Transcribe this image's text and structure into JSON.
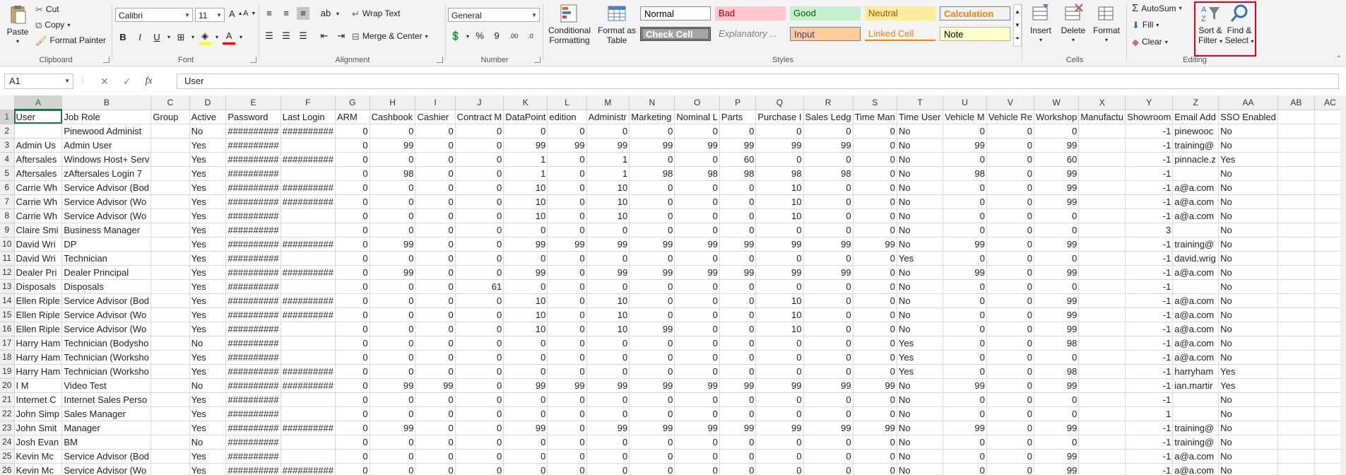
{
  "ribbon": {
    "clipboard": {
      "paste": "Paste",
      "cut": "Cut",
      "copy": "Copy",
      "format_painter": "Format Painter",
      "group": "Clipboard"
    },
    "font": {
      "name": "Calibri",
      "size": "11",
      "bold": "B",
      "italic": "I",
      "underline": "U",
      "group": "Font"
    },
    "alignment": {
      "wrap_text": "Wrap Text",
      "merge_center": "Merge & Center",
      "group": "Alignment"
    },
    "number": {
      "format": "General",
      "percent": "%",
      "comma": "9",
      "group": "Number"
    },
    "styles": {
      "conditional": "Conditional Formatting",
      "format_table": "Format as Table",
      "cells": [
        "Normal",
        "Bad",
        "Good",
        "Neutral",
        "Calculation",
        "Check Cell",
        "Explanatory ...",
        "Input",
        "Linked Cell",
        "Note"
      ],
      "group": "Styles"
    },
    "cells_group": {
      "insert": "Insert",
      "delete": "Delete",
      "format": "Format",
      "group": "Cells"
    },
    "editing": {
      "autosum": "AutoSum",
      "fill": "Fill",
      "clear": "Clear",
      "sort_filter": "Sort & Filter",
      "find_select": "Find & Select",
      "group": "Editing"
    }
  },
  "formula_bar": {
    "cell_ref": "A1",
    "fx": "fx",
    "content": "User"
  },
  "sheet": {
    "columns": [
      "A",
      "B",
      "C",
      "D",
      "E",
      "F",
      "G",
      "H",
      "I",
      "J",
      "K",
      "L",
      "M",
      "N",
      "O",
      "P",
      "Q",
      "R",
      "S",
      "T",
      "U",
      "V",
      "W",
      "X",
      "Y",
      "Z",
      "AA",
      "AB",
      "AC"
    ],
    "rows": [
      [
        "User",
        "Job Role",
        "Group",
        "Active",
        "Password",
        "Last Login",
        "ARM",
        "Cashbook",
        "Cashier",
        "Contract M",
        "DataPoint",
        "edition",
        "Administr",
        "Marketing",
        "Nominal L",
        "Parts",
        "Purchase I",
        "Sales Ledg",
        "Time Man",
        "Time User",
        "Vehicle M",
        "Vehicle Re",
        "Workshop",
        "Manufactu",
        "Showroom",
        "Email Add",
        "SSO Enabled",
        "",
        ""
      ],
      [
        "",
        "Pinewood Administ",
        "",
        "No",
        "##########",
        "##########",
        "0",
        "0",
        "0",
        "0",
        "0",
        "0",
        "0",
        "0",
        "0",
        "0",
        "0",
        "0",
        "0",
        "No",
        "0",
        "0",
        "0",
        "",
        "-1",
        "pinewooc",
        "No",
        "",
        ""
      ],
      [
        "Admin Us",
        "Admin User",
        "",
        "Yes",
        "##########",
        "",
        "0",
        "99",
        "0",
        "0",
        "99",
        "99",
        "99",
        "99",
        "99",
        "99",
        "99",
        "99",
        "0",
        "No",
        "99",
        "0",
        "99",
        "",
        "-1",
        "training@",
        "No",
        "",
        ""
      ],
      [
        "Aftersales",
        "Windows Host+ Serv",
        "",
        "Yes",
        "##########",
        "##########",
        "0",
        "0",
        "0",
        "0",
        "1",
        "0",
        "1",
        "0",
        "0",
        "60",
        "0",
        "0",
        "0",
        "No",
        "0",
        "0",
        "60",
        "",
        "-1",
        "pinnacle.z",
        "Yes",
        "",
        ""
      ],
      [
        "Aftersales",
        "zAftersales Login 7",
        "",
        "Yes",
        "##########",
        "",
        "0",
        "98",
        "0",
        "0",
        "1",
        "0",
        "1",
        "98",
        "98",
        "98",
        "98",
        "98",
        "0",
        "No",
        "98",
        "0",
        "99",
        "",
        "-1",
        "",
        "No",
        "",
        ""
      ],
      [
        "Carrie Wh",
        "Service Advisor (Bod",
        "",
        "Yes",
        "##########",
        "##########",
        "0",
        "0",
        "0",
        "0",
        "10",
        "0",
        "10",
        "0",
        "0",
        "0",
        "10",
        "0",
        "0",
        "No",
        "0",
        "0",
        "99",
        "",
        "-1",
        "a@a.com",
        "No",
        "",
        ""
      ],
      [
        "Carrie Wh",
        "Service Advisor (Wo",
        "",
        "Yes",
        "##########",
        "##########",
        "0",
        "0",
        "0",
        "0",
        "10",
        "0",
        "10",
        "0",
        "0",
        "0",
        "10",
        "0",
        "0",
        "No",
        "0",
        "0",
        "99",
        "",
        "-1",
        "a@a.com",
        "No",
        "",
        ""
      ],
      [
        "Carrie Wh",
        "Service Advisor (Wo",
        "",
        "Yes",
        "##########",
        "",
        "0",
        "0",
        "0",
        "0",
        "10",
        "0",
        "10",
        "0",
        "0",
        "0",
        "10",
        "0",
        "0",
        "No",
        "0",
        "0",
        "0",
        "",
        "-1",
        "a@a.com",
        "No",
        "",
        ""
      ],
      [
        "Claire Smi",
        "Business Manager",
        "",
        "Yes",
        "##########",
        "",
        "0",
        "0",
        "0",
        "0",
        "0",
        "0",
        "0",
        "0",
        "0",
        "0",
        "0",
        "0",
        "0",
        "No",
        "0",
        "0",
        "0",
        "",
        "3",
        "",
        "No",
        "",
        ""
      ],
      [
        "David Wri",
        "DP",
        "",
        "Yes",
        "##########",
        "##########",
        "0",
        "99",
        "0",
        "0",
        "99",
        "99",
        "99",
        "99",
        "99",
        "99",
        "99",
        "99",
        "99",
        "No",
        "99",
        "0",
        "99",
        "",
        "-1",
        "training@",
        "No",
        "",
        ""
      ],
      [
        "David Wri",
        "Technician",
        "",
        "Yes",
        "##########",
        "",
        "0",
        "0",
        "0",
        "0",
        "0",
        "0",
        "0",
        "0",
        "0",
        "0",
        "0",
        "0",
        "0",
        "Yes",
        "0",
        "0",
        "0",
        "",
        "-1",
        "david.wrig",
        "No",
        "",
        ""
      ],
      [
        "Dealer Pri",
        "Dealer Principal",
        "",
        "Yes",
        "##########",
        "##########",
        "0",
        "99",
        "0",
        "0",
        "99",
        "0",
        "99",
        "99",
        "99",
        "99",
        "99",
        "99",
        "0",
        "No",
        "99",
        "0",
        "99",
        "",
        "-1",
        "a@a.com",
        "No",
        "",
        ""
      ],
      [
        "Disposals",
        "Disposals",
        "",
        "Yes",
        "##########",
        "",
        "0",
        "0",
        "0",
        "61",
        "0",
        "0",
        "0",
        "0",
        "0",
        "0",
        "0",
        "0",
        "0",
        "No",
        "0",
        "0",
        "0",
        "",
        "-1",
        "",
        "No",
        "",
        ""
      ],
      [
        "Ellen Riple",
        "Service Advisor (Bod",
        "",
        "Yes",
        "##########",
        "##########",
        "0",
        "0",
        "0",
        "0",
        "10",
        "0",
        "10",
        "0",
        "0",
        "0",
        "10",
        "0",
        "0",
        "No",
        "0",
        "0",
        "99",
        "",
        "-1",
        "a@a.com",
        "No",
        "",
        ""
      ],
      [
        "Ellen Riple",
        "Service Advisor (Wo",
        "",
        "Yes",
        "##########",
        "##########",
        "0",
        "0",
        "0",
        "0",
        "10",
        "0",
        "10",
        "0",
        "0",
        "0",
        "10",
        "0",
        "0",
        "No",
        "0",
        "0",
        "99",
        "",
        "-1",
        "a@a.com",
        "No",
        "",
        ""
      ],
      [
        "Ellen Riple",
        "Service Advisor (Wo",
        "",
        "Yes",
        "##########",
        "",
        "0",
        "0",
        "0",
        "0",
        "10",
        "0",
        "10",
        "99",
        "0",
        "0",
        "10",
        "0",
        "0",
        "No",
        "0",
        "0",
        "99",
        "",
        "-1",
        "a@a.com",
        "No",
        "",
        ""
      ],
      [
        "Harry Ham",
        "Technician (Bodysho",
        "",
        "No",
        "##########",
        "",
        "0",
        "0",
        "0",
        "0",
        "0",
        "0",
        "0",
        "0",
        "0",
        "0",
        "0",
        "0",
        "0",
        "Yes",
        "0",
        "0",
        "98",
        "",
        "-1",
        "a@a.com",
        "No",
        "",
        ""
      ],
      [
        "Harry Ham",
        "Technician (Worksho",
        "",
        "Yes",
        "##########",
        "",
        "0",
        "0",
        "0",
        "0",
        "0",
        "0",
        "0",
        "0",
        "0",
        "0",
        "0",
        "0",
        "0",
        "Yes",
        "0",
        "0",
        "0",
        "",
        "-1",
        "a@a.com",
        "No",
        "",
        ""
      ],
      [
        "Harry Ham",
        "Technician (Worksho",
        "",
        "Yes",
        "##########",
        "##########",
        "0",
        "0",
        "0",
        "0",
        "0",
        "0",
        "0",
        "0",
        "0",
        "0",
        "0",
        "0",
        "0",
        "Yes",
        "0",
        "0",
        "98",
        "",
        "-1",
        "harryham",
        "Yes",
        "",
        ""
      ],
      [
        "I M",
        "Video Test",
        "",
        "No",
        "##########",
        "##########",
        "0",
        "99",
        "99",
        "0",
        "99",
        "99",
        "99",
        "99",
        "99",
        "99",
        "99",
        "99",
        "99",
        "No",
        "99",
        "0",
        "99",
        "",
        "-1",
        "ian.martir",
        "Yes",
        "",
        ""
      ],
      [
        "Internet C",
        "Internet Sales Perso",
        "",
        "Yes",
        "##########",
        "",
        "0",
        "0",
        "0",
        "0",
        "0",
        "0",
        "0",
        "0",
        "0",
        "0",
        "0",
        "0",
        "0",
        "No",
        "0",
        "0",
        "0",
        "",
        "-1",
        "",
        "No",
        "",
        ""
      ],
      [
        "John Simp",
        "Sales Manager",
        "",
        "Yes",
        "##########",
        "",
        "0",
        "0",
        "0",
        "0",
        "0",
        "0",
        "0",
        "0",
        "0",
        "0",
        "0",
        "0",
        "0",
        "No",
        "0",
        "0",
        "0",
        "",
        "1",
        "",
        "No",
        "",
        ""
      ],
      [
        "John Smit",
        "Manager",
        "",
        "Yes",
        "##########",
        "##########",
        "0",
        "99",
        "0",
        "0",
        "99",
        "0",
        "99",
        "99",
        "99",
        "99",
        "99",
        "99",
        "99",
        "No",
        "99",
        "0",
        "99",
        "",
        "-1",
        "training@",
        "No",
        "",
        ""
      ],
      [
        "Josh Evan",
        "BM",
        "",
        "No",
        "##########",
        "",
        "0",
        "0",
        "0",
        "0",
        "0",
        "0",
        "0",
        "0",
        "0",
        "0",
        "0",
        "0",
        "0",
        "No",
        "0",
        "0",
        "0",
        "",
        "-1",
        "training@",
        "No",
        "",
        ""
      ],
      [
        "Kevin Mc",
        "Service Advisor (Bod",
        "",
        "Yes",
        "##########",
        "",
        "0",
        "0",
        "0",
        "0",
        "0",
        "0",
        "0",
        "0",
        "0",
        "0",
        "0",
        "0",
        "0",
        "No",
        "0",
        "0",
        "99",
        "",
        "-1",
        "a@a.com",
        "No",
        "",
        ""
      ],
      [
        "Kevin Mc",
        "Service Advisor (Wo",
        "",
        "Yes",
        "##########",
        "##########",
        "0",
        "0",
        "0",
        "0",
        "0",
        "0",
        "0",
        "0",
        "0",
        "0",
        "0",
        "0",
        "0",
        "No",
        "0",
        "0",
        "99",
        "",
        "-1",
        "a@a.com",
        "No",
        "",
        ""
      ]
    ]
  }
}
